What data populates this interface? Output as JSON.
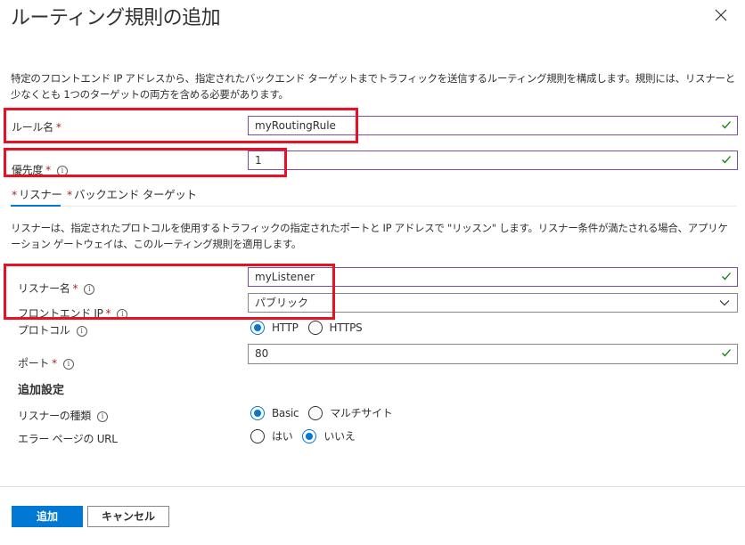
{
  "header": {
    "title": "ルーティング規則の追加",
    "close_icon": "close-icon"
  },
  "description": "特定のフロントエンド IP アドレスから、指定されたバックエンド ターゲットまでトラフィックを送信するルーティング規則を構成します。規則には、リスナーと少なくとも 1つのターゲットの両方を含める必要があります。",
  "rule_name": {
    "label": "ルール名",
    "required": "*",
    "value": "myRoutingRule"
  },
  "priority": {
    "label": "優先度",
    "required": "*",
    "value": "1"
  },
  "tabs": [
    {
      "required": "*",
      "label": "リスナー",
      "selected": true
    },
    {
      "required": "*",
      "label": "バックエンド ターゲット",
      "selected": false
    }
  ],
  "listener": {
    "description": "リスナーは、指定されたプロトコルを使用するトラフィックの指定されたポートと IP アドレスで \"リッスン\" します。リスナー条件が満たされる場合、アプリケーション ゲートウェイは、このルーティング規則を適用します。",
    "name": {
      "label": "リスナー名",
      "required": "*",
      "value": "myListener"
    },
    "frontend_ip": {
      "label": "フロントエンド IP",
      "required": "*",
      "value": "パブリック"
    },
    "protocol": {
      "label": "プロトコル",
      "options": [
        "HTTP",
        "HTTPS"
      ],
      "selected": "HTTP"
    },
    "port": {
      "label": "ポート",
      "required": "*",
      "value": "80"
    },
    "additional_settings_title": "追加設定",
    "listener_type": {
      "label": "リスナーの種類",
      "options": [
        "Basic",
        "マルチサイト"
      ],
      "selected": "Basic"
    },
    "error_page_url": {
      "label": "エラー ページの URL",
      "options": [
        "はい",
        "いいえ"
      ],
      "selected": "いいえ"
    }
  },
  "footer": {
    "add_label": "追加",
    "cancel_label": "キャンセル"
  },
  "colors": {
    "accent": "#0078d4",
    "valid_check": "#107c10",
    "required": "#a4262c",
    "highlight_box": "#e81123"
  }
}
